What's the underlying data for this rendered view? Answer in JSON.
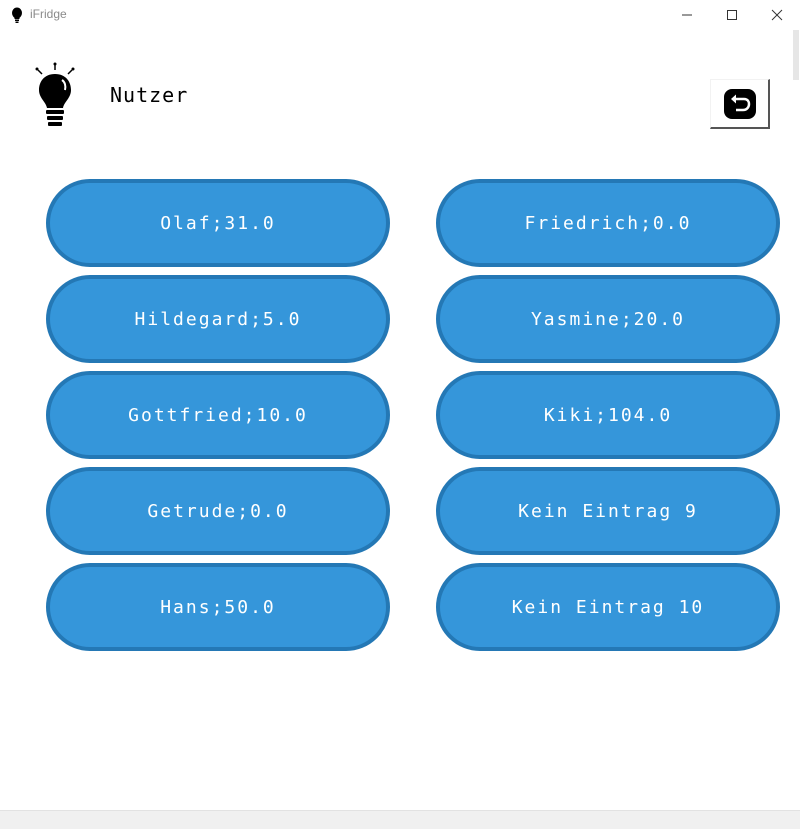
{
  "window": {
    "title": "iFridge"
  },
  "header": {
    "title": "Nutzer"
  },
  "users": {
    "left": [
      {
        "label": "Olaf;31.0"
      },
      {
        "label": "Hildegard;5.0"
      },
      {
        "label": "Gottfried;10.0"
      },
      {
        "label": "Getrude;0.0"
      },
      {
        "label": "Hans;50.0"
      }
    ],
    "right": [
      {
        "label": "Friedrich;0.0"
      },
      {
        "label": "Yasmine;20.0"
      },
      {
        "label": "Kiki;104.0"
      },
      {
        "label": "Kein Eintrag 9"
      },
      {
        "label": "Kein Eintrag 10"
      }
    ]
  },
  "icons": {
    "app": "lightbulb-icon",
    "logo": "lightbulb-icon",
    "back": "back-arrow-icon",
    "minimize": "minimize-icon",
    "maximize": "maximize-icon",
    "close": "close-icon"
  },
  "colors": {
    "button_fill": "#3596da",
    "button_border": "#2478b5",
    "button_text": "#ffffff"
  }
}
